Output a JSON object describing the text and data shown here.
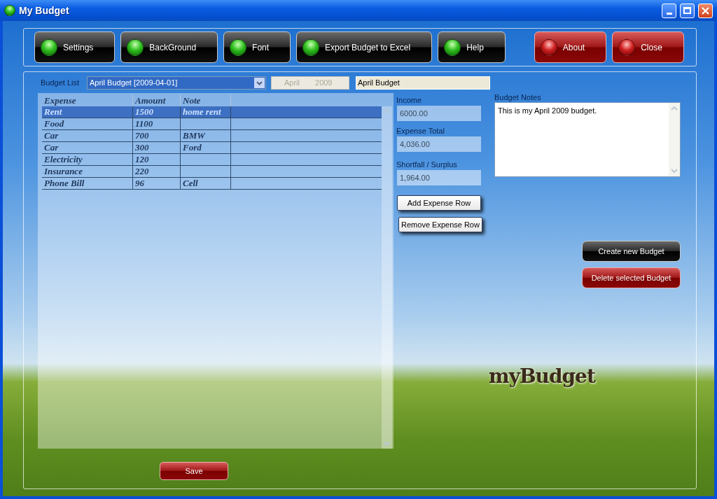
{
  "window": {
    "title": "My Budget"
  },
  "toolbar": [
    {
      "label": "Settings",
      "kind": "dark"
    },
    {
      "label": "BackGround",
      "kind": "dark"
    },
    {
      "label": "Font",
      "kind": "dark"
    },
    {
      "label": "Export Budget to Excel",
      "kind": "dark"
    },
    {
      "label": "Help",
      "kind": "dark"
    },
    {
      "label": "About",
      "kind": "red"
    },
    {
      "label": "Close",
      "kind": "red"
    }
  ],
  "budget_list": {
    "label": "Budget List",
    "value": "April Budget [2009-04-01]"
  },
  "date_picker": {
    "month": "April",
    "year": "2009",
    "disabled": true
  },
  "budget_name": {
    "value": "April Budget"
  },
  "table": {
    "columns": [
      "Expense",
      "Amount",
      "Note"
    ],
    "rows": [
      {
        "cells": [
          "Rent",
          "1500",
          "home rent"
        ],
        "selected": true
      },
      {
        "cells": [
          "Food",
          "1100",
          ""
        ],
        "selected": false
      },
      {
        "cells": [
          "Car",
          "700",
          "BMW"
        ],
        "selected": false
      },
      {
        "cells": [
          "Car",
          "300",
          "Ford"
        ],
        "selected": false
      },
      {
        "cells": [
          "Electricity",
          "120",
          ""
        ],
        "selected": false
      },
      {
        "cells": [
          "Insurance",
          "220",
          ""
        ],
        "selected": false
      },
      {
        "cells": [
          "Phone Bill",
          "96",
          "Cell"
        ],
        "selected": false
      }
    ]
  },
  "summary": [
    {
      "label": "Income",
      "value": "6000.00"
    },
    {
      "label": "Expense Total",
      "value": "4,036.00"
    },
    {
      "label": "Shortfall / Surplus",
      "value": "1,964.00"
    }
  ],
  "row_buttons": [
    "Add Expense Row",
    "Remove Expense Row"
  ],
  "notes": {
    "label": "Budget Notes",
    "value": "This is my April 2009 budget."
  },
  "budget_buttons": [
    {
      "label": "Create new Budget",
      "kind": "dark"
    },
    {
      "label": "Delete selected Budget",
      "kind": "red"
    }
  ],
  "logo": "myBudget",
  "save_button": {
    "label": "Save",
    "kind": "red"
  }
}
